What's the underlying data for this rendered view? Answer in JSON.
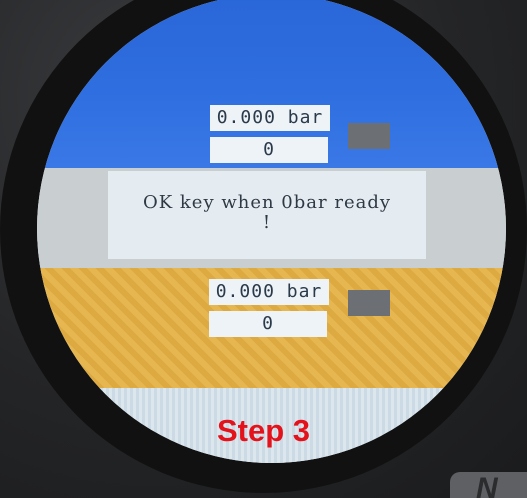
{
  "panel_top": {
    "pressure_value": "0.000 bar",
    "counter_value": "0"
  },
  "message": {
    "line1": "OK key when 0bar ready",
    "line2": "!"
  },
  "panel_bottom": {
    "pressure_value": "0.000 bar",
    "counter_value": "0"
  },
  "step": {
    "label": "Step 3"
  },
  "colors": {
    "top_band": "#2f6fe0",
    "message_band": "#c9ced1",
    "bottom_band": "#e4b044",
    "step_text": "#e3121b",
    "indicator": "#6c7075"
  },
  "icons": {
    "status_indicator_top": "gray-square-indicator",
    "status_indicator_bottom": "gray-square-indicator"
  }
}
